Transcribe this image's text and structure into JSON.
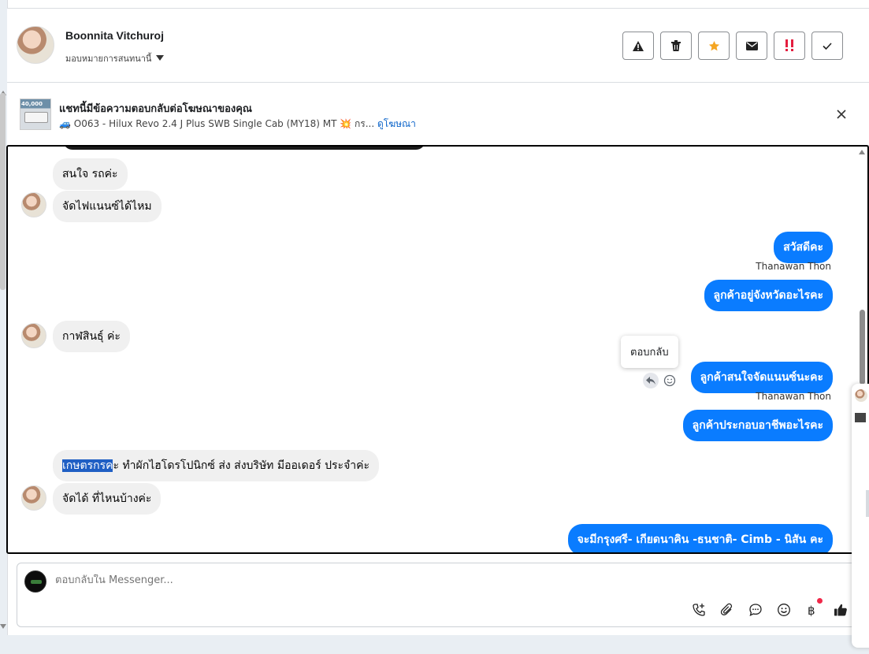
{
  "header": {
    "contact_name": "Boonnita Vitchuroj",
    "assign_label": "มอบหมายการสนทนานี้",
    "actions": [
      {
        "name": "spam",
        "icon": "warning-icon"
      },
      {
        "name": "delete",
        "icon": "trash-icon"
      },
      {
        "name": "star",
        "icon": "star-icon"
      },
      {
        "name": "mark-unread",
        "icon": "envelope-icon"
      },
      {
        "name": "follow-up",
        "icon": "exclamation-icon"
      },
      {
        "name": "done",
        "icon": "check-icon"
      }
    ],
    "star_color": "#f5a623",
    "followup_color": "#e41e3f"
  },
  "ad": {
    "title": "แชทนี้มีข้อความตอบกลับต่อโฆษณาของคุณ",
    "subtitle": "🚙 O063 - Hilux Revo 2.4 J Plus SWB Single Cab (MY18) MT 💥 กร...",
    "link": "ดูโฆษณา",
    "thumb_tag": "40,000"
  },
  "messages": {
    "m1": "สนใจ รถค่ะ",
    "m2": "จัดไฟแนนซ์ได้ไหม",
    "m3": "สวัสดีคะ",
    "m3_sender": "Thanawan Thon",
    "m4": "ลูกค้าอยู่จังหวัดอะไรคะ",
    "m5": "กาฬสินธุ์ ค่ะ",
    "m6": "ลูกค้าสนใจจัดแนนซ์นะคะ",
    "m6_sender": "Thanawan Thon",
    "m7": "ลูกค้าประกอบอาชีพอะไรคะ",
    "m8_highlight": "เกษตรกรค",
    "m8_rest": "ะ ทำผักไฮโดรโปนิกซ์ ส่ง ส่งบริษัท   มีออเดอร์ ประจำค่ะ",
    "m9": "จัดได้ ที่ไหนบ้างค่ะ",
    "m10": "จะมีกรุงศรี- เกียดนาคิน -ธนชาติ- Cimb - นิสัน คะ"
  },
  "tooltip": {
    "reply_label": "ตอบกลับ"
  },
  "composer": {
    "placeholder": "ตอบกลับใน Messenger...",
    "tools": [
      "call-add-icon",
      "attachment-icon",
      "saved-reply-icon",
      "emoji-icon",
      "baht-icon",
      "like-icon"
    ]
  },
  "colors": {
    "outgoing_bubble": "#0a7cff",
    "incoming_bubble": "#f0f0f0",
    "link": "#0a63c9"
  }
}
